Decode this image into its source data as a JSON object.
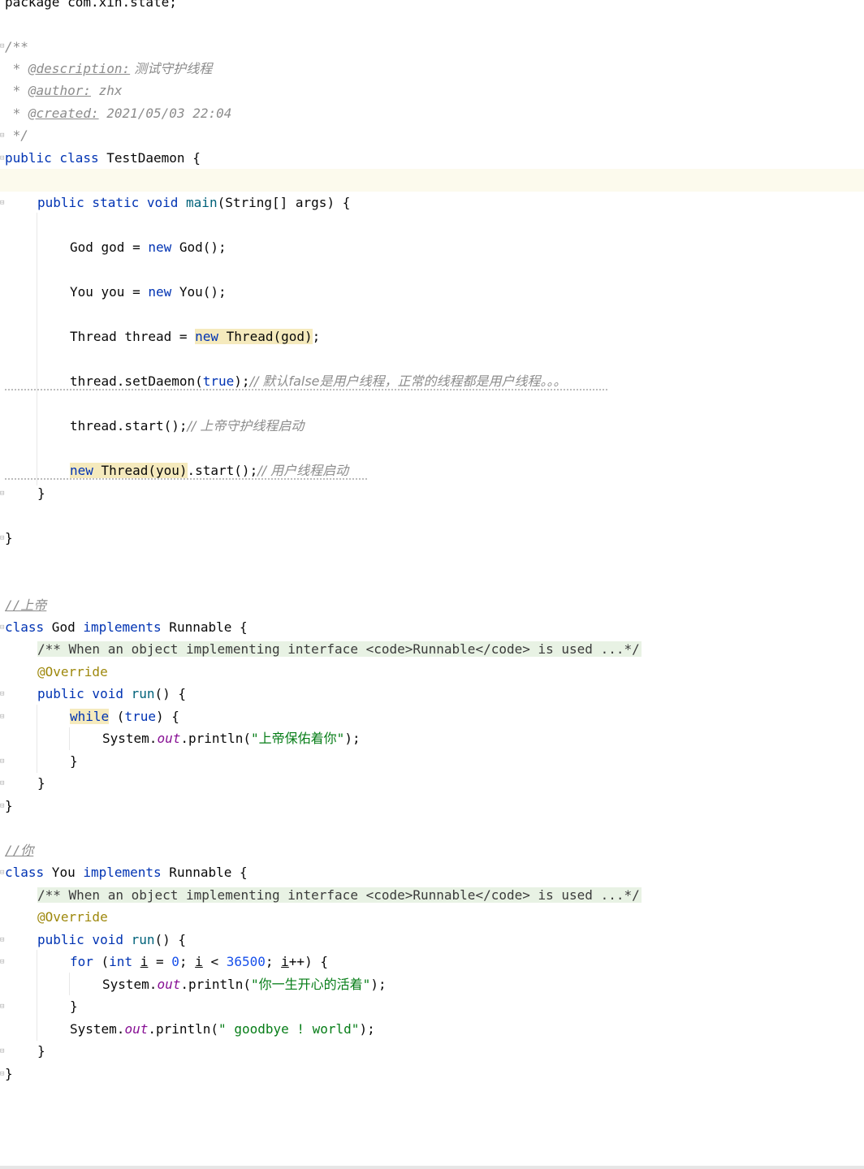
{
  "editor": {
    "l_package": "package com.xin.state;",
    "l_doc_open": "/**",
    "doc": {
      "star": " * ",
      "desc_tag": "@description:",
      "desc_val": " 测试守护线程",
      "author_tag": "@author:",
      "author_val": " zhx",
      "created_tag": "@created:",
      "created_val": " 2021/05/03 22:04",
      "close": " */"
    },
    "test": {
      "kw_public": "public",
      "kw_class": " class",
      "name": " TestDaemon {",
      "kw_public2": "public",
      "kw_static": " static",
      "kw_void": " void",
      "main_name": " main",
      "main_args": "(String[] args) {",
      "god_a": "God god = ",
      "kw_new": "new",
      "god_b": " God();",
      "you_a": "You you = ",
      "you_b": " You();",
      "thr_a": "Thread thread = ",
      "thr_hl_new": "new",
      "thr_hl_rest": " Thread(god)",
      "thr_end": ";",
      "setd_a": "thread.setDaemon(",
      "kw_true": "true",
      "setd_b": ");",
      "setd_cm": "// 默认false是用户线程，正常的线程都是用户线程。。。",
      "start_a": "thread.start();",
      "start_cm": "// 上帝守护线程启动",
      "you_thread_new": "new",
      "you_thread_rest": " Thread(you)",
      "you_thread_b": ".start();",
      "you_thread_cm": "// 用户线程启动",
      "close_method": "}",
      "close_class": "}"
    },
    "god": {
      "cm": "//上帝",
      "kw_class": "class",
      "name": " God ",
      "kw_impl": "implements",
      "iface": " Runnable {",
      "folded_doc": "/** When an object implementing interface <code>Runnable</code> is used ...*/",
      "override": "@Override",
      "kw_public": "public",
      "kw_void": " void",
      "run": " run",
      "run_b": "() {",
      "kw_while": "while",
      "while_a": " (",
      "kw_true": "true",
      "while_b": ") {",
      "print_a": "System.",
      "out": "out",
      "print_b": ".println(",
      "str": "\"上帝保佑着你\"",
      "print_c": ");",
      "close1": "}",
      "close2": "}",
      "close3": "}"
    },
    "you": {
      "cm": "//你",
      "kw_class": "class",
      "name": " You ",
      "kw_impl": "implements",
      "iface": " Runnable {",
      "folded_doc": "/** When an object implementing interface <code>Runnable</code> is used ...*/",
      "override": "@Override",
      "kw_public": "public",
      "kw_void": " void",
      "run": " run",
      "run_b": "() {",
      "kw_for": "for",
      "for_a": " (",
      "kw_int": "int",
      "for_i1": "i",
      "for_eq": " = ",
      "n0": "0",
      "for_semi": "; ",
      "for_i2": "i",
      "for_lt": " < ",
      "n36500": "36500",
      "for_semi2": "; ",
      "for_i3": "i",
      "for_end": "++) {",
      "print_a": "System.",
      "out": "out",
      "print_b": ".println(",
      "str": "\"你一生开心的活着\"",
      "print_c": ");",
      "close_for": "}",
      "bye_a": "System.",
      "bye_out": "out",
      "bye_b": ".println(",
      "bye_str": "\" goodbye ! world\"",
      "bye_c": ");",
      "close_method": "}",
      "close_class": "}"
    }
  },
  "colors": {
    "keyword": "#0033b3",
    "string": "#067d17",
    "comment": "#8c8c8c",
    "number": "#1750eb",
    "field": "#871094",
    "annotation": "#9e880d",
    "highlight": "#f5eabd",
    "caret_row": "#fcfaed",
    "folded_doc_bg": "#e8f2e4"
  }
}
